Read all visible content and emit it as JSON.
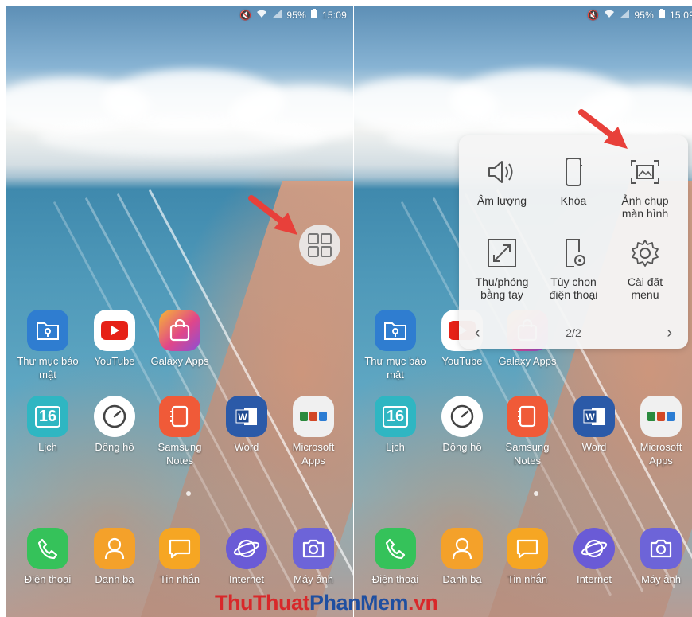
{
  "status_bar": {
    "battery": "95%",
    "time": "15:09"
  },
  "home_apps": {
    "row1": [
      {
        "label": "Thư mục bảo mật",
        "icon": "secure-folder-icon",
        "color": "#2f7dd0"
      },
      {
        "label": "YouTube",
        "icon": "youtube-icon",
        "color": "#ffffff"
      },
      {
        "label": "Galaxy Apps",
        "icon": "galaxy-apps-icon",
        "color": "#e0468a"
      }
    ],
    "row2": [
      {
        "label": "Lịch",
        "icon": "calendar-icon",
        "color": "#2fb6c2",
        "badge": "16"
      },
      {
        "label": "Đồng hồ",
        "icon": "clock-icon",
        "color": "#ffffff"
      },
      {
        "label": "Samsung Notes",
        "icon": "notes-icon",
        "color": "#f05a38"
      },
      {
        "label": "Word",
        "icon": "word-icon",
        "color": "#2b5aa8"
      },
      {
        "label": "Microsoft Apps",
        "icon": "ms-folder-icon",
        "color": "#f0f0f0"
      }
    ],
    "dock": [
      {
        "label": "Điện thoại",
        "icon": "phone-icon",
        "color": "#35c25a"
      },
      {
        "label": "Danh bạ",
        "icon": "contacts-icon",
        "color": "#f4a12a"
      },
      {
        "label": "Tin nhắn",
        "icon": "messages-icon",
        "color": "#f6a623"
      },
      {
        "label": "Internet",
        "icon": "internet-icon",
        "color": "#6a5bd6"
      },
      {
        "label": "Máy ảnh",
        "icon": "camera-icon",
        "color": "#6d64d8"
      }
    ]
  },
  "assistant_menu": {
    "items": [
      {
        "label": "Âm lượng",
        "icon": "volume-icon"
      },
      {
        "label": "Khóa",
        "icon": "lock-phone-icon"
      },
      {
        "label": "Ảnh chụp màn hình",
        "label_line1": "Ảnh chụp",
        "label_line2": "màn hình",
        "icon": "screenshot-icon"
      },
      {
        "label": "Thu/phóng bằng tay",
        "label_line1": "Thu/phóng",
        "label_line2": "bằng tay",
        "icon": "zoom-icon"
      },
      {
        "label": "Tùy chọn điện thoại",
        "label_line1": "Tùy chọn",
        "label_line2": "điện thoại",
        "icon": "phone-settings-icon"
      },
      {
        "label": "Cài đặt menu",
        "label_line1": "Cài đặt",
        "label_line2": "menu",
        "icon": "gear-icon"
      }
    ],
    "page": "2/2"
  },
  "watermark": {
    "part1": "ThuThuat",
    "part2": "PhanMem",
    "part3": ".vn"
  },
  "colors": {
    "arrow": "#e8403a",
    "watermark_red": "#d8282a",
    "watermark_blue": "#1f4fa0"
  }
}
